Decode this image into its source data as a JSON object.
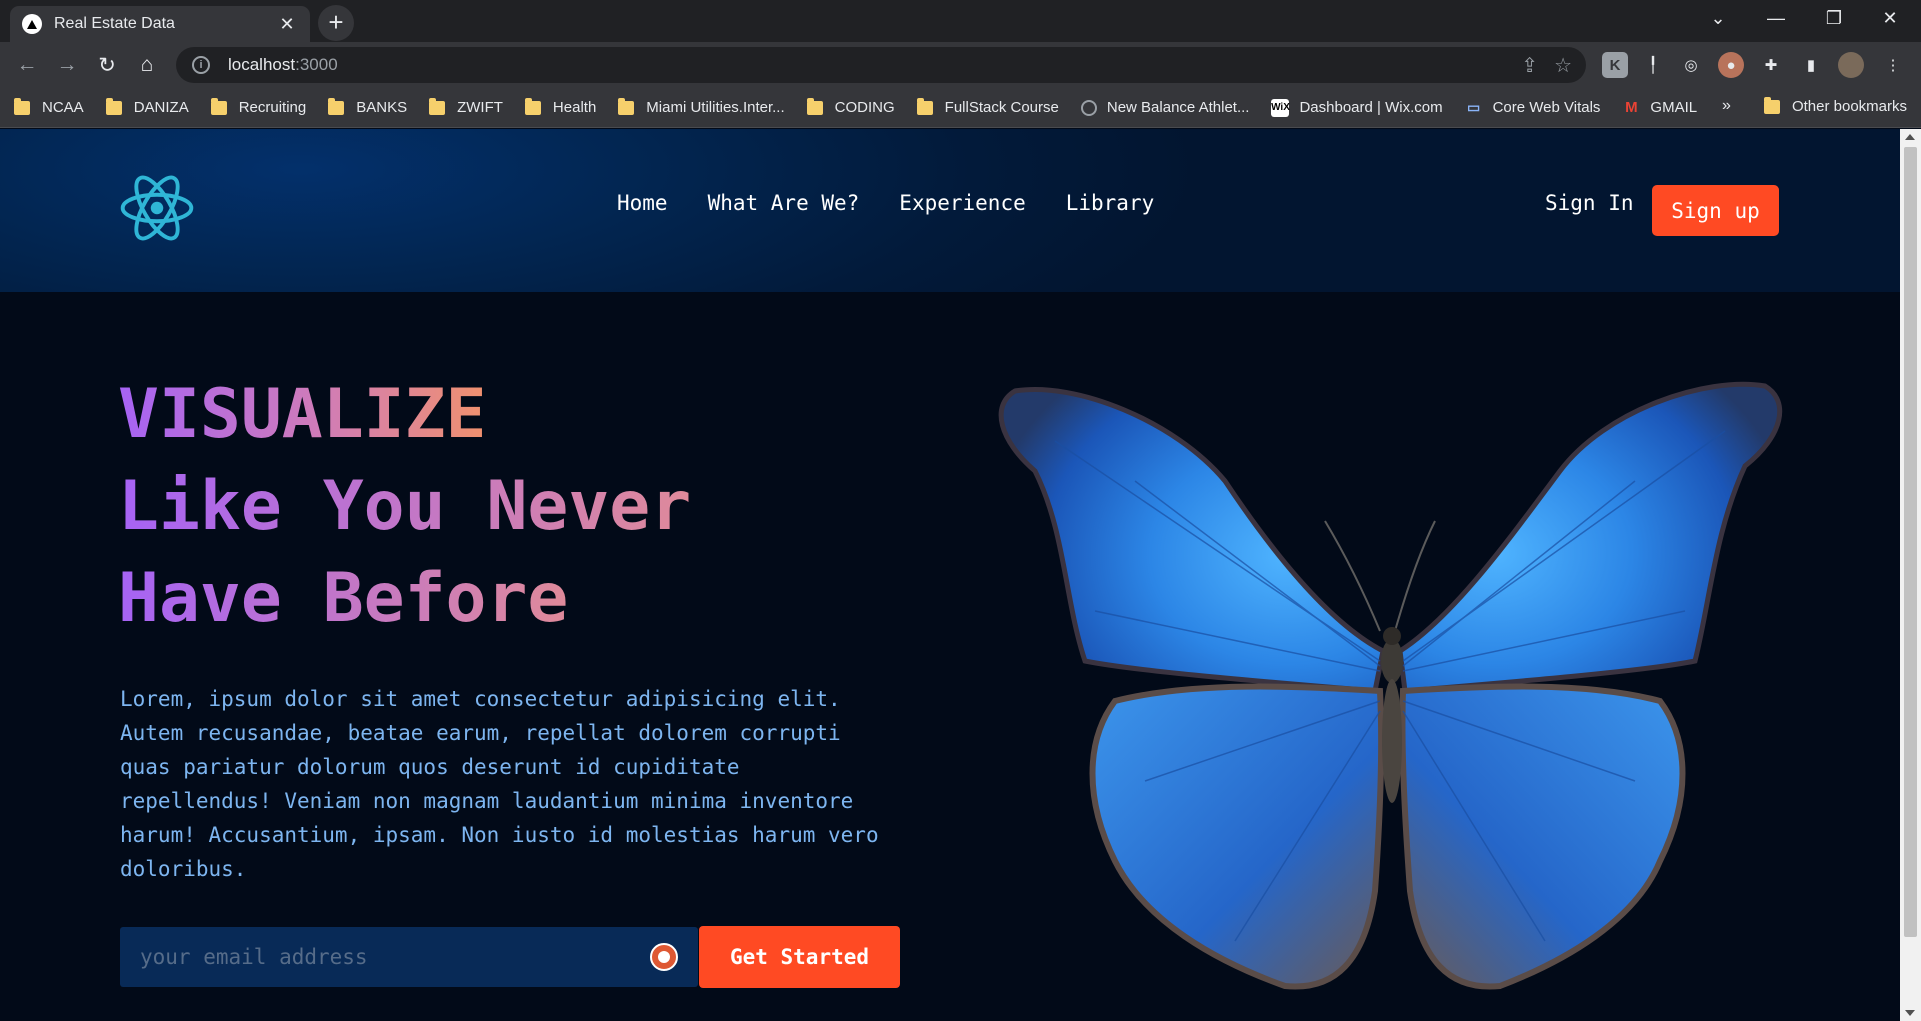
{
  "browser": {
    "tab_title": "Real Estate Data",
    "url_host": "localhost",
    "url_port": ":3000",
    "bookmarks": [
      {
        "label": "NCAA",
        "icon": "folder-icon"
      },
      {
        "label": "DANIZA",
        "icon": "folder-icon"
      },
      {
        "label": "Recruiting",
        "icon": "folder-icon"
      },
      {
        "label": "BANKS",
        "icon": "folder-icon"
      },
      {
        "label": "ZWIFT",
        "icon": "folder-icon"
      },
      {
        "label": "Health",
        "icon": "folder-icon"
      },
      {
        "label": "Miami Utilities.Inter...",
        "icon": "folder-icon"
      },
      {
        "label": "CODING",
        "icon": "folder-icon"
      },
      {
        "label": "FullStack Course",
        "icon": "folder-icon"
      },
      {
        "label": "New Balance Athlet...",
        "icon": "globe-icon"
      },
      {
        "label": "Dashboard | Wix.com",
        "icon": "wix-icon"
      },
      {
        "label": "Core Web Vitals",
        "icon": "web-vitals-icon"
      },
      {
        "label": "GMAIL",
        "icon": "gmail-icon"
      }
    ],
    "bookmarks_more": "»",
    "other_bookmarks": "Other bookmarks"
  },
  "site": {
    "nav": [
      "Home",
      "What Are We?",
      "Experience",
      "Library"
    ],
    "signin_label": "Sign In",
    "signup_label": "Sign up"
  },
  "hero": {
    "line1": "VISUALIZE",
    "line2": "Like You Never",
    "line3": "Have Before",
    "body": "Lorem, ipsum dolor sit amet consectetur adipisicing elit. Autem recusandae, beatae earum, repellat dolorem corrupti quas pariatur dolorum quos deserunt id cupiditate repellendus! Veniam non magnam laudantium minima inventore harum! Accusantium, ipsam. Non iusto id molestias harum vero doloribus.",
    "email_placeholder": "your email address",
    "cta_label": "Get Started"
  },
  "colors": {
    "accent": "#ff4a23",
    "header_bg": "#022550",
    "page_bg": "#020a18",
    "body_text": "#7db5f0",
    "logo": "#2fb6d6"
  }
}
